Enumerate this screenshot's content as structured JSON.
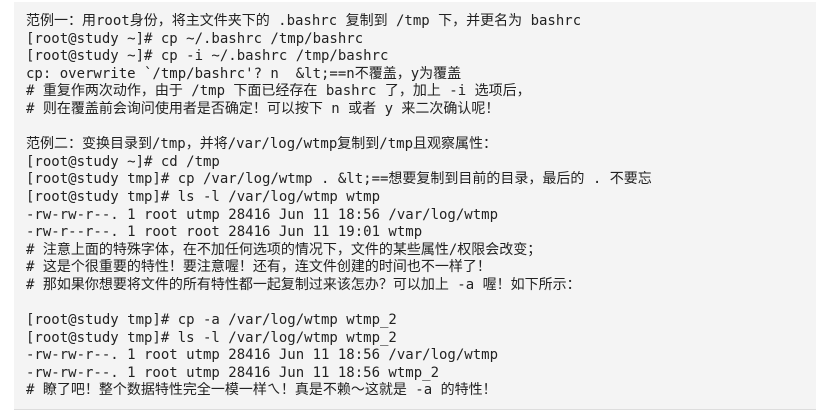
{
  "code_block": {
    "lines": [
      "范例一：用root身份，将主文件夹下的 .bashrc 复制到 /tmp 下，并更名为 bashrc",
      "[root@study ~]# cp ~/.bashrc /tmp/bashrc",
      "[root@study ~]# cp -i ~/.bashrc /tmp/bashrc",
      "cp: overwrite `/tmp/bashrc'? n  &lt;==n不覆盖，y为覆盖",
      "# 重复作两次动作，由于 /tmp 下面已经存在 bashrc 了，加上 -i 选项后，",
      "# 则在覆盖前会询问使用者是否确定！可以按下 n 或者 y 来二次确认呢！",
      "",
      "范例二：变换目录到/tmp，并将/var/log/wtmp复制到/tmp且观察属性：",
      "[root@study ~]# cd /tmp",
      "[root@study tmp]# cp /var/log/wtmp . &lt;==想要复制到目前的目录，最后的 . 不要忘",
      "[root@study tmp]# ls -l /var/log/wtmp wtmp",
      "-rw-rw-r--. 1 root utmp 28416 Jun 11 18:56 /var/log/wtmp",
      "-rw-r--r--. 1 root root 28416 Jun 11 19:01 wtmp",
      "# 注意上面的特殊字体，在不加任何选项的情况下，文件的某些属性/权限会改变；",
      "# 这是个很重要的特性！要注意喔！还有，连文件创建的时间也不一样了！",
      "# 那如果你想要将文件的所有特性都一起复制过来该怎办？可以加上 -a 喔！如下所示：",
      "",
      "[root@study tmp]# cp -a /var/log/wtmp wtmp_2",
      "[root@study tmp]# ls -l /var/log/wtmp wtmp_2",
      "-rw-rw-r--. 1 root utmp 28416 Jun 11 18:56 /var/log/wtmp",
      "-rw-rw-r--. 1 root utmp 28416 Jun 11 18:56 wtmp_2",
      "# 瞭了吧！整个数据特性完全一模一样ㄟ！真是不赖～这就是 -a 的特性！"
    ]
  }
}
